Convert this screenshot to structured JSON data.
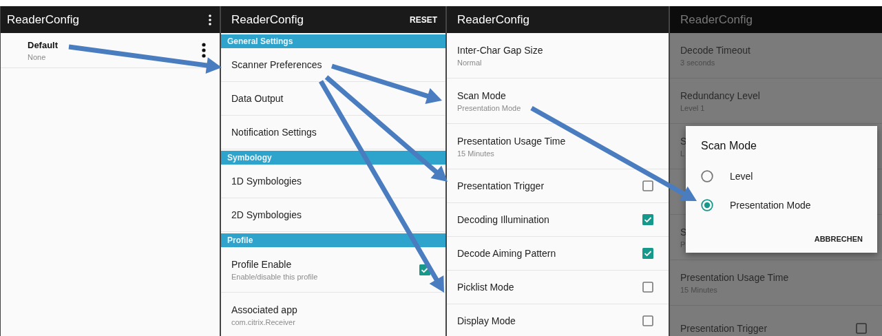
{
  "panels": [
    {
      "title": "ReaderConfig",
      "overflow_menu": true,
      "items": [
        {
          "kind": "profile",
          "title": "Default",
          "summary": "None"
        }
      ]
    },
    {
      "title": "ReaderConfig",
      "action": "RESET",
      "items": [
        {
          "kind": "header",
          "title": "General Settings"
        },
        {
          "kind": "pref",
          "title": "Scanner Preferences"
        },
        {
          "kind": "pref",
          "title": "Data Output"
        },
        {
          "kind": "pref",
          "title": "Notification Settings"
        },
        {
          "kind": "header",
          "title": "Symbology"
        },
        {
          "kind": "pref",
          "title": "1D Symbologies"
        },
        {
          "kind": "pref",
          "title": "2D Symbologies"
        },
        {
          "kind": "header",
          "title": "Profile"
        },
        {
          "kind": "checkbox",
          "title": "Profile Enable",
          "summary": "Enable/disable this profile",
          "checked": true
        },
        {
          "kind": "pref",
          "title": "Associated app",
          "summary": "com.citrix.Receiver"
        }
      ]
    },
    {
      "title": "ReaderConfig",
      "items": [
        {
          "kind": "pref",
          "title": "Inter-Char Gap Size",
          "summary": "Normal"
        },
        {
          "kind": "pref",
          "title": "Scan Mode",
          "summary": "Presentation Mode"
        },
        {
          "kind": "pref",
          "title": "Presentation Usage Time",
          "summary": "15 Minutes"
        },
        {
          "kind": "checkbox",
          "title": "Presentation Trigger",
          "checked": false
        },
        {
          "kind": "checkbox",
          "title": "Decoding Illumination",
          "checked": true
        },
        {
          "kind": "checkbox",
          "title": "Decode Aiming Pattern",
          "checked": true
        },
        {
          "kind": "checkbox",
          "title": "Picklist Mode",
          "checked": false
        },
        {
          "kind": "checkbox",
          "title": "Display Mode",
          "checked": false
        }
      ]
    },
    {
      "title": "ReaderConfig",
      "items": [
        {
          "kind": "pref",
          "title": "Decode Timeout",
          "summary": "3 seconds"
        },
        {
          "kind": "pref",
          "title": "Redundancy Level",
          "summary": "Level 1"
        },
        {
          "kind": "pref",
          "title": "S",
          "summary": "L"
        },
        {
          "kind": "pref"
        },
        {
          "kind": "pref",
          "title": "S",
          "summary": "P"
        },
        {
          "kind": "pref",
          "title": "Presentation Usage Time",
          "summary": "15 Minutes"
        },
        {
          "kind": "checkbox",
          "title": "Presentation Trigger",
          "checked": false
        }
      ],
      "dialog": {
        "title": "Scan Mode",
        "options": [
          {
            "label": "Level",
            "selected": false
          },
          {
            "label": "Presentation Mode",
            "selected": true
          }
        ],
        "button": "ABBRECHEN"
      }
    }
  ]
}
